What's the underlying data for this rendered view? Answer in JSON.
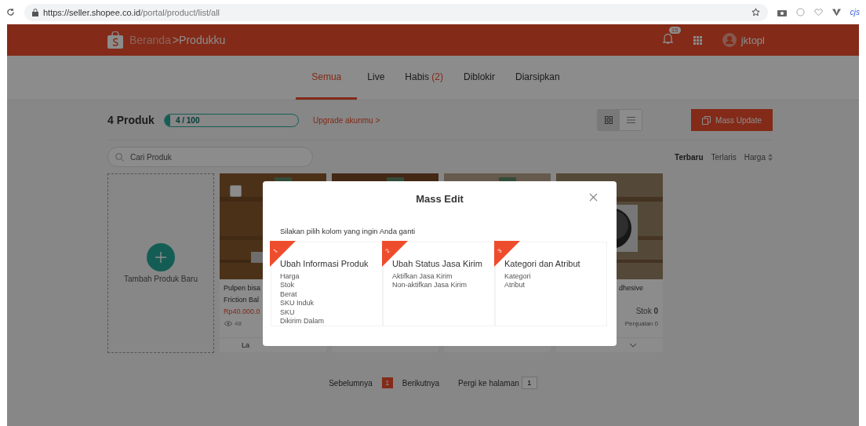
{
  "browser": {
    "url_host": "https://seller.shopee.co.id",
    "url_path": "/portal/product/list/all",
    "extension_label": "cjs"
  },
  "header": {
    "breadcrumb": [
      {
        "label": "Beranda",
        "selected": false
      },
      {
        "label": ">Produkku",
        "selected": true
      }
    ],
    "notification_count": "15",
    "user": "jktopl"
  },
  "tabs": [
    {
      "label": "Semua",
      "selected": true
    },
    {
      "label": "Live",
      "selected": false
    },
    {
      "label": "Habis",
      "count": "(2)",
      "selected": false
    },
    {
      "label": "Diblokir",
      "selected": false
    },
    {
      "label": "Diarsipkan",
      "selected": false
    }
  ],
  "summary": {
    "count_label": "4 Produk",
    "quota": "4 / 100",
    "level": 0.04,
    "upgrade_link": "Upgrade akunmu >",
    "mass_update": "Mass Update"
  },
  "view_modes": [
    {
      "kind": "grid",
      "selected": true
    },
    {
      "kind": "list",
      "selected": false
    }
  ],
  "search": {
    "placeholder": "Cari Produk"
  },
  "sort": [
    {
      "label": "Terbaru",
      "selected": true,
      "kind": "plain"
    },
    {
      "label": "Terlaris",
      "selected": false,
      "kind": "plain"
    },
    {
      "label": "Harga",
      "selected": false,
      "kind": "sortable"
    }
  ],
  "add_product": {
    "label": "Tambah Produk Baru"
  },
  "products": [
    {
      "kind": "picture",
      "checked": false,
      "title_lines": [
        "Pulpen bisa",
        "Friction Bal"
      ],
      "price": "Rp40.000.0",
      "views": "48",
      "footer": "La"
    },
    {
      "kind": "picture"
    },
    {
      "kind": "picture"
    },
    {
      "kind": "picture",
      "title_lines": [
        "dhesive"
      ],
      "stock_label": "Stok",
      "stock": "0",
      "sales": "Penjualan 0",
      "menu": true
    }
  ],
  "pagination": {
    "prev": "Sebelumnya",
    "pages": [
      {
        "label": "1",
        "selected": true
      }
    ],
    "next": "Berikutnya",
    "goto_label": "Pergi ke halaman",
    "goto_value": "1"
  },
  "modal": {
    "title": "Mass Edit",
    "instruction": "Silakan pilih kolom yang ingin Anda ganti",
    "options": [
      {
        "number": "1",
        "title": "Ubah Informasi Produk",
        "items": [
          "Harga",
          "Stok",
          "Berat",
          "SKU Induk",
          "SKU",
          "Dikirim Dalam"
        ]
      },
      {
        "number": "2",
        "title": "Ubah Status Jasa Kirim",
        "items": [
          "Aktifkan Jasa Kirim",
          "Non-aktifkan Jasa Kirim"
        ]
      },
      {
        "number": "3",
        "title": "Kategori dan Atribut",
        "items": [
          "Kategori",
          "Atribut"
        ]
      }
    ]
  }
}
